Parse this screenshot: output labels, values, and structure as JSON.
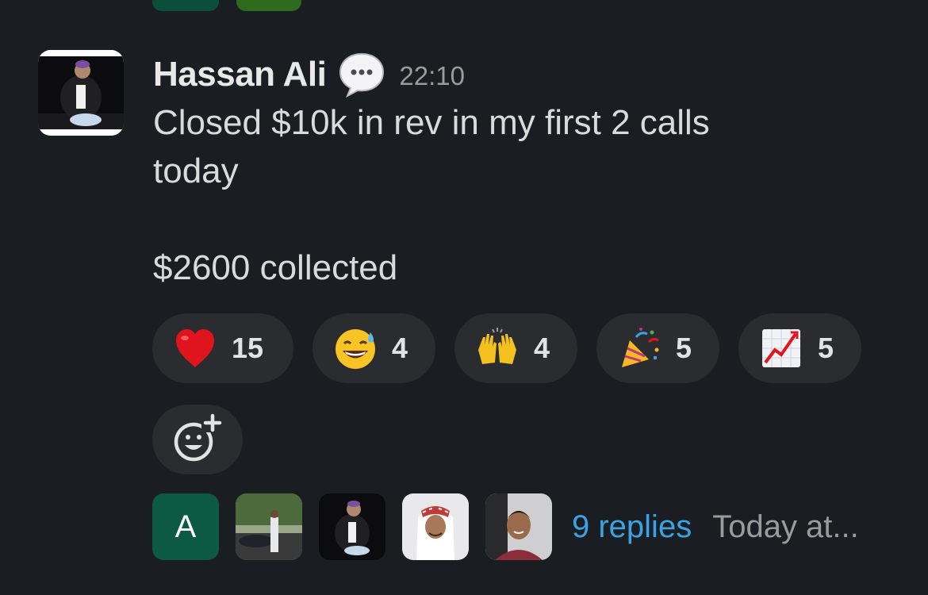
{
  "message": {
    "author": "Hassan Ali",
    "status_icon": "speech-bubble-icon",
    "time": "22:10",
    "text": "Closed $10k in rev in my first 2 calls\ntoday\n\n$2600 collected"
  },
  "reactions": [
    {
      "emoji": "heart-icon",
      "count": "15"
    },
    {
      "emoji": "sweat-smile-icon",
      "count": "4"
    },
    {
      "emoji": "raised-hands-icon",
      "count": "4"
    },
    {
      "emoji": "party-popper-icon",
      "count": "5"
    },
    {
      "emoji": "chart-increasing-icon",
      "count": "5"
    }
  ],
  "add_reaction_icon": "add-reaction-icon",
  "thread": {
    "first_avatar_letter": "A",
    "replies_label": "9 replies",
    "last_reply_label": "Today at..."
  },
  "colors": {
    "background": "#1a1d21",
    "reaction_pill": "#2a2c30",
    "link": "#3aa3e3",
    "letter_avatar": "#0c5a43"
  }
}
